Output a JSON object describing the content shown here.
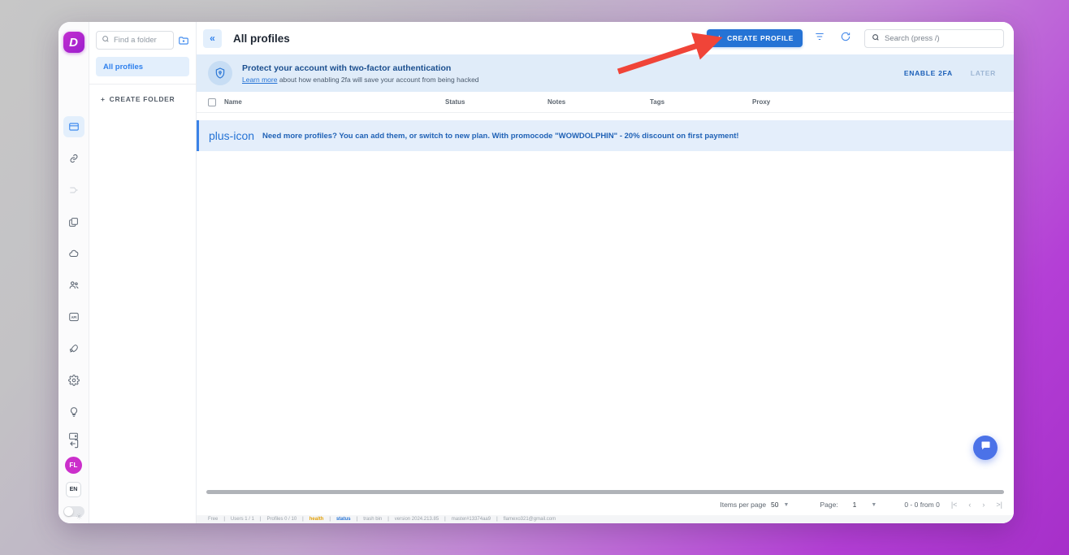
{
  "app": {
    "logo_letter": "D",
    "theme_toggle_icon": "sun-icon"
  },
  "icon_rail": {
    "items": [
      {
        "name": "browser-profiles-icon",
        "label": "Browser profiles",
        "active": true
      },
      {
        "name": "link-icon",
        "label": "Links",
        "active": false
      },
      {
        "name": "automation-icon",
        "label": "Automation",
        "active": false
      },
      {
        "name": "copy-icon",
        "label": "Extensions",
        "active": false
      },
      {
        "name": "cloud-icon",
        "label": "Cloud",
        "active": false
      },
      {
        "name": "team-icon",
        "label": "Team",
        "active": false
      },
      {
        "name": "api-icon",
        "label": "API",
        "active": false
      },
      {
        "name": "rocket-icon",
        "label": "Boost",
        "active": false
      },
      {
        "name": "gear-icon",
        "label": "Settings",
        "active": false
      },
      {
        "name": "lightbulb-icon",
        "label": "Tips",
        "active": false
      },
      {
        "name": "logout-icon",
        "label": "Log out",
        "active": false
      }
    ],
    "wallet_icon": "wallet-icon",
    "avatar_initials": "FL",
    "language": "EN"
  },
  "folder_panel": {
    "search_placeholder": "Find a folder",
    "new_folder_icon": "new-folder-icon",
    "items": [
      {
        "label": "All profiles",
        "selected": true
      }
    ],
    "create_folder_label": "Create folder"
  },
  "topbar": {
    "collapse_icon": "chevron-double-left-icon",
    "title": "All profiles",
    "create_profile_label": "Create profile",
    "filter_icon": "filter-icon",
    "refresh_icon": "refresh-icon",
    "search_placeholder": "Search (press /)"
  },
  "banner_2fa": {
    "shield_icon": "shield-key-icon",
    "title": "Protect your account with two-factor authentication",
    "link_text": "Learn more",
    "subtitle_rest": " about how enabling 2fa will save your account from being hacked",
    "enable_label": "Enable 2FA",
    "later_label": "Later"
  },
  "table": {
    "columns": [
      "Name",
      "Status",
      "Notes",
      "Tags",
      "Proxy"
    ],
    "rows": [],
    "promo": {
      "plus_icon": "plus-icon",
      "text": "Need more profiles? You can add them, or switch to new plan. With promocode \"WOWDOLPHIN\" - 20% discount on first payment!"
    }
  },
  "chat": {
    "icon": "chat-bubble-icon"
  },
  "pager": {
    "items_per_page_label": "Items per page",
    "items_per_page_value": "50",
    "page_label": "Page:",
    "page_value": "1",
    "range_text": "0 - 0 from 0",
    "first_icon": "|<",
    "prev_icon": "‹",
    "next_icon": "›",
    "last_icon": ">|"
  },
  "status_strip": {
    "plan": "Free",
    "users": "Users 1 / 1",
    "profiles": "Profiles 0 / 10",
    "health": "health",
    "status": "status",
    "trash": "trash bin",
    "version": "version 2024.213.85",
    "build": "master#13374aa9",
    "account": "flamexo321@gmail.com"
  },
  "annotation": {
    "arrow_color": "#f04438",
    "arrow_target": "create-profile-button"
  },
  "colors": {
    "accent_blue": "#2573d5",
    "banner_bg": "#e0ecf9",
    "promo_bg": "#e4eefb",
    "brand_purple": "#c22ed0",
    "avatar": "#cb2fcb",
    "chat_blue": "#4b72e8"
  }
}
